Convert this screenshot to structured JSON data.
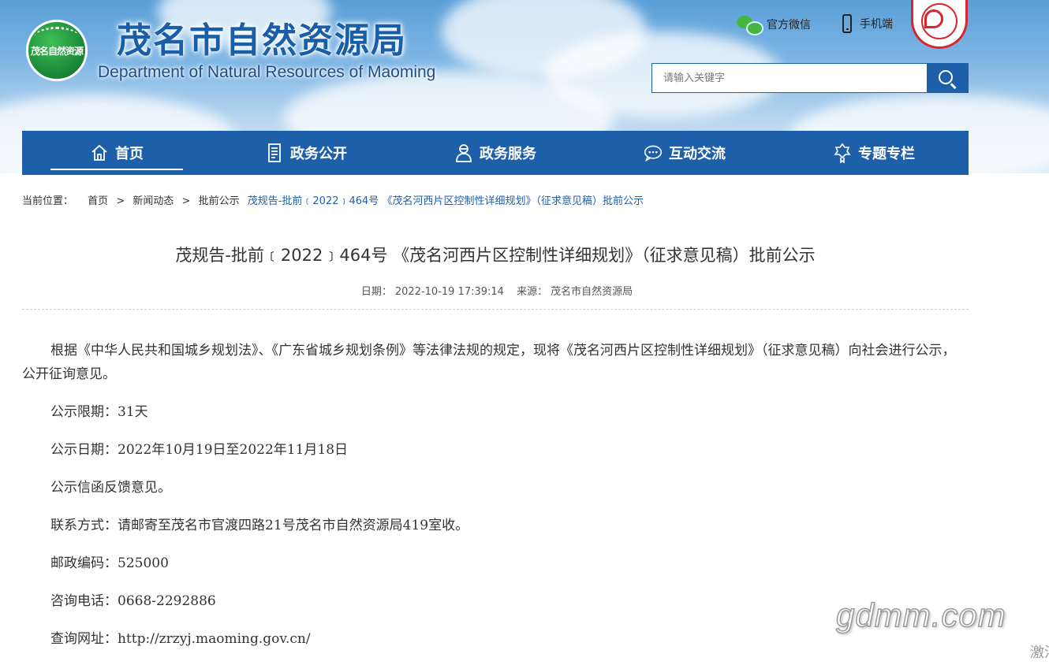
{
  "header": {
    "logo_text": "茂名自然资源",
    "title_cn": "茂名市自然资源局",
    "title_en": "Department of Natural Resources of Maoming",
    "links": [
      {
        "label": "官方微信",
        "icon": "wechat-icon"
      },
      {
        "label": "手机端",
        "icon": "phone-icon"
      }
    ],
    "seal_icon": "maoming-emblem-icon",
    "search": {
      "placeholder": "请输入关键字"
    }
  },
  "nav": {
    "items": [
      {
        "label": "首页",
        "icon": "home-icon",
        "active": true
      },
      {
        "label": "政务公开",
        "icon": "document-icon",
        "active": false
      },
      {
        "label": "政务服务",
        "icon": "service-person-icon",
        "active": false
      },
      {
        "label": "互动交流",
        "icon": "chat-icon",
        "active": false
      },
      {
        "label": "专题专栏",
        "icon": "medal-icon",
        "active": false
      }
    ]
  },
  "breadcrumb": {
    "prefix": "当前位置：",
    "items": [
      "首页",
      "新闻动态",
      "批前公示"
    ],
    "current": "茂规告-批前﹝2022﹞464号 《茂名河西片区控制性详细规划》（征求意见稿）批前公示"
  },
  "article": {
    "title": "茂规告-批前﹝2022﹞464号 《茂名河西片区控制性详细规划》（征求意见稿）批前公示",
    "date_label": "日期：",
    "date": "2022-10-19 17:39:14",
    "source_label": "来源：",
    "source": "茂名市自然资源局",
    "paragraphs": [
      "根据《中华人民共和国城乡规划法》、《广东省城乡规划条例》等法律法规的规定，现将《茂名河西片区控制性详细规划》（征求意见稿）向社会进行公示，公开征询意见。",
      "公示限期：31天",
      "公示日期：2022年10月19日至2022年11月18日",
      "公示信函反馈意见。",
      "联系方式：请邮寄至茂名市官渡四路21号茂名市自然资源局419室收。",
      "邮政编码：525000",
      "咨询电话：0668-2292886",
      "查询网址：http://zrzyj.maoming.gov.cn/"
    ]
  },
  "overlay": {
    "watermark": "gdmm.com",
    "activate": "激活"
  },
  "colors": {
    "brand": "#1e5fa9",
    "logo_green": "#1d8c3a",
    "seal_red": "#d7262d"
  }
}
